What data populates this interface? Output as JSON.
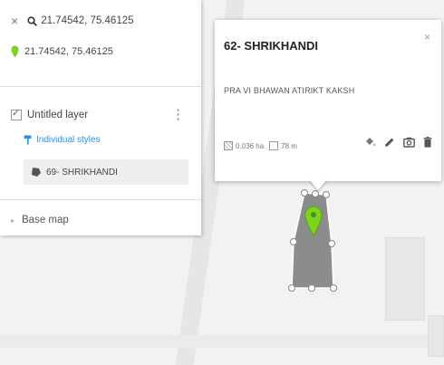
{
  "search": {
    "query": "21.74542, 75.46125"
  },
  "location": {
    "coords": "21.74542, 75.46125"
  },
  "layer": {
    "name": "Untitled layer",
    "styles_label": "Individual styles",
    "feature_label": "69- SHRIKHANDI"
  },
  "base_map": {
    "label": "Base map"
  },
  "popup": {
    "title": "62- SHRIKHANDI",
    "description": "PRA VI BHAWAN ATIRIKT KAKSH",
    "area": "0.036 ha",
    "perimeter": "78 m",
    "close": "×"
  },
  "colors": {
    "pin_green": "#7ed321",
    "link_blue": "#2a8ee6",
    "polygon_fill": "#8c8c8c"
  },
  "icons": [
    "close-icon",
    "search-icon",
    "map-pin-icon",
    "kebab-menu-icon",
    "paint-roller-icon",
    "polygon-icon",
    "style-bucket-icon",
    "edit-pencil-icon",
    "camera-icon",
    "trash-icon"
  ]
}
